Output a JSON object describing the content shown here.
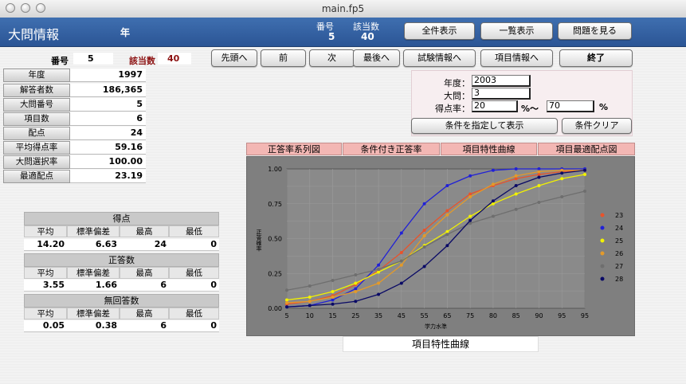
{
  "window": {
    "title": "main.fp5"
  },
  "header": {
    "title": "大問情報",
    "year_label": "年",
    "no_label": "番号",
    "no_value": "5",
    "count_label": "該当数",
    "count_value": "40",
    "buttons": [
      "全件表示",
      "一覧表示",
      "問題を見る"
    ]
  },
  "record": {
    "no_label": "番号",
    "no_value": "5",
    "count_label": "該当数",
    "count_value": "40"
  },
  "nav_buttons": [
    "先頭へ",
    "前",
    "次",
    "最後へ",
    "試験情報へ",
    "項目情報へ",
    "終了"
  ],
  "info_fields": [
    {
      "label": "年度",
      "value": "1997"
    },
    {
      "label": "解答者数",
      "value": "186,365"
    },
    {
      "label": "大問番号",
      "value": "5"
    },
    {
      "label": "項目数",
      "value": "6"
    },
    {
      "label": "配点",
      "value": "24"
    },
    {
      "label": "平均得点率",
      "value": "59.16"
    },
    {
      "label": "大問選択率",
      "value": "100.00"
    },
    {
      "label": "最適配点",
      "value": "23.19"
    }
  ],
  "conditions": {
    "year_label": "年度：",
    "year_value": "2003",
    "q_label": "大問：",
    "q_value": "3",
    "rate_label": "得点率：",
    "rate_from": "20",
    "rate_sep": "%〜",
    "rate_to": "70",
    "rate_unit": "%",
    "show_button": "条件を指定して表示",
    "clear_button": "条件クリア"
  },
  "tabs": [
    "正答率系列図",
    "条件付き正答率",
    "項目特性曲線",
    "項目最適配点図"
  ],
  "stats": {
    "score": {
      "title": "得点",
      "labels": [
        "平均",
        "標準偏差",
        "最高",
        "最低"
      ],
      "values": [
        "14.20",
        "6.63",
        "24",
        "0"
      ]
    },
    "correct": {
      "title": "正答数",
      "labels": [
        "平均",
        "標準偏差",
        "最高",
        "最低"
      ],
      "values": [
        "3.55",
        "1.66",
        "6",
        "0"
      ]
    },
    "noanswer": {
      "title": "無回答数",
      "labels": [
        "平均",
        "標準偏差",
        "最高",
        "最低"
      ],
      "values": [
        "0.05",
        "0.38",
        "6",
        "0"
      ]
    }
  },
  "caption": "項目特性曲線",
  "chart_data": {
    "type": "line",
    "title": "",
    "xlabel": "学力水準",
    "ylabel": "正答確率",
    "x": [
      5,
      10,
      15,
      25,
      35,
      45,
      55,
      65,
      75,
      80,
      85,
      90,
      95,
      95
    ],
    "xlim_label": "ordinal",
    "ylim": [
      0,
      1
    ],
    "yticks": [
      "0.00",
      "0.25",
      "0.50",
      "0.75",
      "1.00"
    ],
    "grid": true,
    "legend": "right",
    "series": [
      {
        "name": "23",
        "color": "#e8532b",
        "values": [
          0.03,
          0.05,
          0.09,
          0.17,
          0.27,
          0.4,
          0.56,
          0.7,
          0.82,
          0.88,
          0.93,
          0.96,
          0.98,
          0.99
        ]
      },
      {
        "name": "24",
        "color": "#2121d6",
        "values": [
          0.01,
          0.02,
          0.06,
          0.14,
          0.31,
          0.54,
          0.75,
          0.88,
          0.95,
          0.99,
          1.0,
          1.0,
          1.0,
          1.0
        ]
      },
      {
        "name": "25",
        "color": "#f2f200",
        "values": [
          0.06,
          0.08,
          0.12,
          0.18,
          0.26,
          0.34,
          0.45,
          0.55,
          0.66,
          0.75,
          0.82,
          0.88,
          0.93,
          0.96
        ]
      },
      {
        "name": "26",
        "color": "#e39a2a",
        "values": [
          0.04,
          0.05,
          0.08,
          0.12,
          0.18,
          0.31,
          0.52,
          0.67,
          0.8,
          0.89,
          0.95,
          0.98,
          0.99,
          0.99
        ]
      },
      {
        "name": "27",
        "color": "#6e6e6e",
        "values": [
          0.13,
          0.16,
          0.2,
          0.24,
          0.28,
          0.34,
          0.44,
          0.53,
          0.61,
          0.66,
          0.71,
          0.76,
          0.8,
          0.84
        ]
      },
      {
        "name": "28",
        "color": "#0a0a66",
        "values": [
          0.01,
          0.02,
          0.03,
          0.05,
          0.1,
          0.18,
          0.3,
          0.45,
          0.63,
          0.77,
          0.88,
          0.94,
          0.97,
          0.99
        ]
      }
    ]
  }
}
